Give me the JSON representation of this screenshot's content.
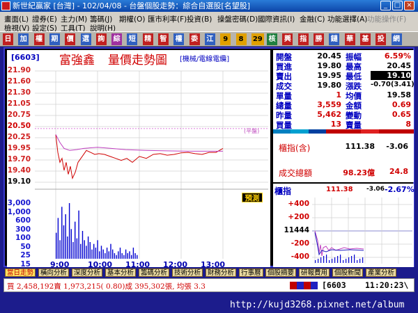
{
  "window": {
    "title": "新世紀贏家 [台灣] - 102/04/08 - 台盤個股走勢：綜合自選股[名望股]",
    "minimize_glyph": "_",
    "maximize_glyph": "□",
    "close_glyph": "×"
  },
  "menu": {
    "row1": [
      "畫面(L)",
      "證券(E)",
      "主力(M)",
      "籌碼(J)",
      "期權(O)",
      "匯市利率(F)",
      "投資(B)",
      "操盤密碼(D)",
      "國際資訊(I)",
      "金融(C)",
      "功能選擇(A)",
      "功能操作(F)"
    ],
    "row2": [
      "檢視(V)",
      "設定(S)",
      "工具(T)",
      "說明(H)"
    ]
  },
  "toolbar": {
    "buttons": [
      "日",
      "加",
      "權",
      "期",
      "價",
      "選",
      "詢",
      "綜",
      "短",
      "精",
      "智",
      "權",
      "委",
      "江",
      "9",
      "8",
      "29",
      "核",
      "興",
      "指",
      "勝",
      "鏈",
      "華",
      "基",
      "投",
      "網"
    ],
    "colors": [
      "#c02020",
      "#3060c0",
      "#c02020",
      "#3060c0",
      "#c02020",
      "#3060c0",
      "#c02020",
      "#a030a0",
      "#3060c0",
      "#c02020",
      "#c02020",
      "#3060c0",
      "#c02020",
      "#3060c0",
      "#e0a000",
      "#e0a000",
      "#e0a000",
      "#208040",
      "#c02020",
      "#c02020",
      "#c02020",
      "#3060c0",
      "#c02020",
      "#c02020",
      "#c02020",
      "#3060c0"
    ]
  },
  "chart": {
    "code": "[6603]",
    "name": "富強鑫",
    "subtitle": "量價走勢圖",
    "mode": "[機械/電線電纜]",
    "ref_label": "(平盤)",
    "predict_label": "預測"
  },
  "chart_data": {
    "type": "line",
    "title": "量價走勢圖",
    "price_ticks": [
      "21.90",
      "21.60",
      "21.30",
      "21.05",
      "20.75",
      "20.50",
      "20.25",
      "19.95",
      "19.70",
      "19.40",
      "19.10"
    ],
    "volume_ticks": [
      "3,000",
      "1,000",
      "600",
      "300",
      "100",
      "50",
      "25",
      "15",
      "張"
    ],
    "x_ticks": [
      "9:00",
      "10:00",
      "11:00",
      "12:00",
      "13:00"
    ],
    "ylim": [
      19.1,
      21.9
    ],
    "reference_price": 20.45,
    "series": [
      {
        "name": "price",
        "x": [
          0,
          3,
          6,
          9,
          12,
          15,
          18,
          21,
          24,
          28,
          32,
          38,
          44,
          50,
          56,
          62,
          70,
          78,
          86,
          94,
          102,
          110,
          120,
          130,
          140,
          150,
          160,
          170,
          180,
          190,
          200,
          210,
          220,
          230,
          240
        ],
        "values": [
          20.3,
          19.85,
          19.6,
          19.7,
          19.4,
          19.6,
          19.3,
          19.5,
          19.2,
          19.35,
          19.6,
          19.75,
          19.9,
          19.85,
          19.8,
          19.82,
          19.8,
          19.75,
          19.7,
          19.65,
          19.7,
          19.6,
          19.75,
          19.7,
          19.8,
          19.82,
          19.78,
          19.8,
          19.84,
          19.85,
          19.82,
          19.8,
          19.85,
          19.85,
          19.95
        ]
      },
      {
        "name": "average",
        "x": [
          0,
          6,
          12,
          20,
          30,
          40,
          60,
          80,
          100,
          130,
          160,
          190,
          220,
          240
        ],
        "values": [
          20.3,
          20.1,
          19.95,
          19.9,
          19.92,
          19.95,
          19.98,
          19.95,
          19.92,
          19.9,
          19.89,
          19.88,
          19.88,
          19.88
        ]
      }
    ],
    "volume": [
      14,
      22,
      10,
      28,
      18,
      24,
      12,
      30,
      16,
      9,
      20,
      11,
      26,
      8,
      15,
      10,
      7,
      12,
      9,
      5,
      8,
      6,
      10,
      4,
      7,
      5,
      3,
      6,
      4,
      8,
      5,
      3,
      2,
      4,
      6,
      3,
      2,
      5,
      3,
      4,
      2,
      6,
      3,
      2
    ]
  },
  "quote": [
    {
      "label": "開盤",
      "value": "20.45",
      "label2": "振幅",
      "value2": "6.59%",
      "c1": "#000",
      "c2": "#d00000"
    },
    {
      "label": "買進",
      "value": "19.80",
      "label2": "最高",
      "value2": "20.45",
      "c1": "#000",
      "c2": "#000"
    },
    {
      "label": "賣出",
      "value": "19.95",
      "label2": "最低",
      "value2": "19.10",
      "c1": "#000",
      "c2": "#fff"
    },
    {
      "label": "成交",
      "value": "19.80",
      "label2": "漲跌",
      "value2": "-0.70(3.41)",
      "c1": "#000",
      "c2": "#000"
    },
    {
      "label": "單量",
      "value": "1",
      "label2": "均價",
      "value2": "19.58",
      "c1": "#d00000",
      "c2": "#000"
    },
    {
      "label": "總量",
      "value": "3,559",
      "label2": "金額",
      "value2": "0.69",
      "c1": "#d00000",
      "c2": "#d00000"
    },
    {
      "label": "昨量",
      "value": "5,462",
      "label2": "變動",
      "value2": "0.65",
      "c1": "#d00000",
      "c2": "#d00000"
    },
    {
      "label": "買量",
      "value": "13",
      "label2": "賣量",
      "value2": "8",
      "c1": "#d00000",
      "c2": "#d00000"
    }
  ],
  "index": {
    "label": "櫃指(含)",
    "value": "111.38",
    "change": "-3.06",
    "total_label": "成交總額",
    "total_value": "98.23億",
    "total_change": "24.8"
  },
  "index_chart": {
    "label": "櫃指",
    "value": "111.38",
    "change": "-3.06",
    "pct": "-2.67%",
    "ticks": [
      "+400",
      "+200",
      "11444",
      "-200",
      "-400"
    ]
  },
  "tabs": [
    "當日走勢",
    "橫向分析",
    "深度分析",
    "基本分析",
    "籌碼分析",
    "技術分析",
    "財務分析",
    "行事曆",
    "個股摘要",
    "研報費用",
    "個股新聞",
    "產業分析"
  ],
  "status": {
    "text": "買 2,458,192賣 1,973,215( 0.80)成 395,302張, 均張 3.3",
    "code": "[6603",
    "time": "11:20:23\\"
  },
  "url": "http://kujd3268.pixnet.net/album"
}
